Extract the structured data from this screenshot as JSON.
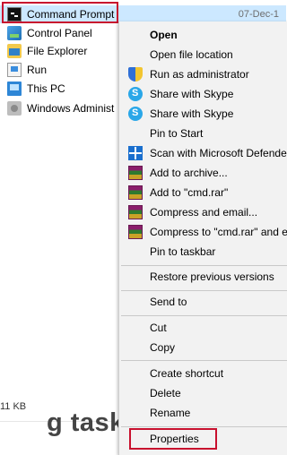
{
  "file_list": {
    "selected": {
      "label": "Command Prompt",
      "date": "07-Dec-1"
    },
    "items": [
      {
        "label": "Control Panel"
      },
      {
        "label": "File Explorer"
      },
      {
        "label": "Run"
      },
      {
        "label": "This PC"
      },
      {
        "label": "Windows Administ"
      }
    ],
    "status_size": "11 KB",
    "heading_fragment": "g tasks"
  },
  "context_menu": {
    "items": [
      {
        "label": "Open",
        "icon": ""
      },
      {
        "label": "Open file location",
        "icon": ""
      },
      {
        "label": "Run as administrator",
        "icon": "uac-shield-icon"
      },
      {
        "label": "Share with Skype",
        "icon": "skype-icon"
      },
      {
        "label": "Share with Skype",
        "icon": "skype-icon"
      },
      {
        "label": "Pin to Start",
        "icon": ""
      },
      {
        "label": "Scan with Microsoft Defende",
        "icon": "defender-icon"
      },
      {
        "label": "Add to archive...",
        "icon": "winrar-icon"
      },
      {
        "label": "Add to \"cmd.rar\"",
        "icon": "winrar-icon"
      },
      {
        "label": "Compress and email...",
        "icon": "winrar-icon"
      },
      {
        "label": "Compress to \"cmd.rar\" and e",
        "icon": "winrar-icon"
      },
      {
        "label": "Pin to taskbar",
        "icon": ""
      },
      {
        "label": "Restore previous versions",
        "icon": ""
      },
      {
        "label": "Send to",
        "icon": ""
      },
      {
        "label": "Cut",
        "icon": ""
      },
      {
        "label": "Copy",
        "icon": ""
      },
      {
        "label": "Create shortcut",
        "icon": ""
      },
      {
        "label": "Delete",
        "icon": ""
      },
      {
        "label": "Rename",
        "icon": ""
      },
      {
        "label": "Properties",
        "icon": ""
      }
    ]
  },
  "colors": {
    "highlight_box": "#c8102e",
    "selection": "#cce8ff",
    "menu_bg": "#f2f2f2"
  }
}
